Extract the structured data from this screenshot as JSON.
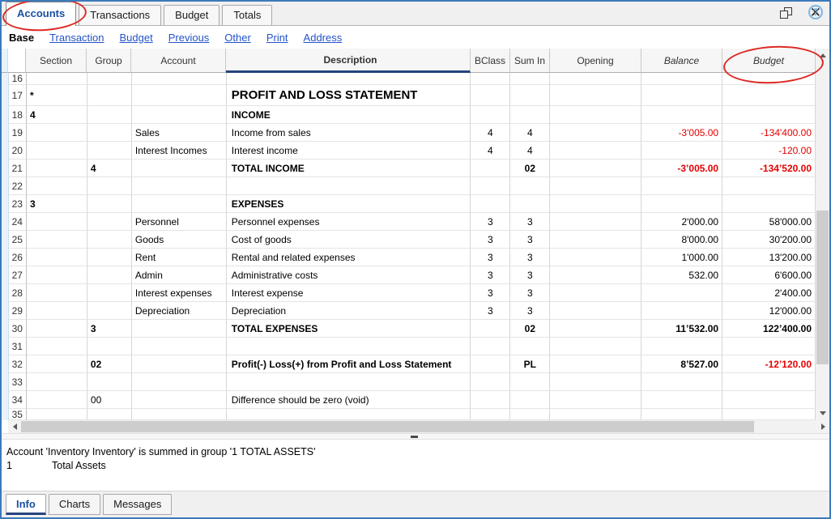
{
  "window_tabs": [
    {
      "label": "Accounts",
      "active": true
    },
    {
      "label": "Transactions",
      "active": false
    },
    {
      "label": "Budget",
      "active": false
    },
    {
      "label": "Totals",
      "active": false
    }
  ],
  "window_controls": {
    "close_glyph": "✕"
  },
  "toolbar": {
    "base_label": "Base",
    "links": [
      "Transaction",
      "Budget",
      "Previous",
      "Other",
      "Print",
      "Address"
    ],
    "help_glyph": "?"
  },
  "grid": {
    "columns": [
      {
        "key": "n",
        "label": "",
        "align": "r"
      },
      {
        "key": "section",
        "label": "Section",
        "align": "l"
      },
      {
        "key": "group",
        "label": "Group",
        "align": "l"
      },
      {
        "key": "account",
        "label": "Account",
        "align": "l"
      },
      {
        "key": "desc",
        "label": "Description",
        "align": "l"
      },
      {
        "key": "bclass",
        "label": "BClass",
        "align": "c"
      },
      {
        "key": "sumin",
        "label": "Sum In",
        "align": "c"
      },
      {
        "key": "opening",
        "label": "Opening",
        "align": "r"
      },
      {
        "key": "balance",
        "label": "Balance",
        "align": "r"
      },
      {
        "key": "budget",
        "label": "Budget",
        "align": "r"
      }
    ],
    "rows": [
      {
        "n": "16"
      },
      {
        "n": "17",
        "section": "*",
        "desc": "PROFIT AND LOSS STATEMENT",
        "bold": true,
        "big": true
      },
      {
        "n": "18",
        "section": "4",
        "desc": "INCOME",
        "bold": true
      },
      {
        "n": "19",
        "account": "Sales",
        "desc": "Income from sales",
        "bclass": "4",
        "sumin": "4",
        "balance": "-3'005.00",
        "budget": "-134'400.00"
      },
      {
        "n": "20",
        "account": "Interest Incomes",
        "desc": "Interest income",
        "bclass": "4",
        "sumin": "4",
        "budget": "-120.00"
      },
      {
        "n": "21",
        "group": "4",
        "desc": "TOTAL INCOME",
        "sumin": "02",
        "balance": "-3’005.00",
        "budget": "-134’520.00",
        "bold": true
      },
      {
        "n": "22"
      },
      {
        "n": "23",
        "section": "3",
        "desc": "EXPENSES",
        "bold": true
      },
      {
        "n": "24",
        "account": "Personnel",
        "desc": "Personnel expenses",
        "bclass": "3",
        "sumin": "3",
        "balance": "2'000.00",
        "budget": "58'000.00"
      },
      {
        "n": "25",
        "account": "Goods",
        "desc": "Cost of goods",
        "bclass": "3",
        "sumin": "3",
        "balance": "8'000.00",
        "budget": "30'200.00"
      },
      {
        "n": "26",
        "account": "Rent",
        "desc": "Rental and related expenses",
        "bclass": "3",
        "sumin": "3",
        "balance": "1'000.00",
        "budget": "13'200.00"
      },
      {
        "n": "27",
        "account": "Admin",
        "desc": "Administrative costs",
        "bclass": "3",
        "sumin": "3",
        "balance": "532.00",
        "budget": "6'600.00"
      },
      {
        "n": "28",
        "account": "Interest expenses",
        "desc": "Interest expense",
        "bclass": "3",
        "sumin": "3",
        "budget": "2'400.00"
      },
      {
        "n": "29",
        "account": "Depreciation",
        "desc": "Depreciation",
        "bclass": "3",
        "sumin": "3",
        "budget": "12'000.00"
      },
      {
        "n": "30",
        "group": "3",
        "desc": "TOTAL EXPENSES",
        "sumin": "02",
        "balance": "11’532.00",
        "budget": "122’400.00",
        "bold": true
      },
      {
        "n": "31"
      },
      {
        "n": "32",
        "group": "02",
        "desc": "Profit(-) Loss(+) from Profit and Loss Statement",
        "sumin": "PL",
        "balance": "8’527.00",
        "budget": "-12’120.00",
        "bold": true
      },
      {
        "n": "33"
      },
      {
        "n": "34",
        "group": "00",
        "desc": "Difference should be zero (void)"
      },
      {
        "n": "35"
      }
    ]
  },
  "info_panel": {
    "line1": "Account 'Inventory Inventory' is summed in group '1 TOTAL ASSETS'",
    "line2_code": "1",
    "line2_label": "Total Assets"
  },
  "bottom_tabs": [
    {
      "label": "Info",
      "active": true
    },
    {
      "label": "Charts",
      "active": false
    },
    {
      "label": "Messages",
      "active": false
    }
  ],
  "colors": {
    "accent_border": "#3c79bb",
    "negative_value": "#e60000",
    "annotation_red": "#dc2a23",
    "link_blue": "#2353c8",
    "active_tab_blue": "#1a4fa3",
    "selected_column_underline": "#26437e"
  }
}
